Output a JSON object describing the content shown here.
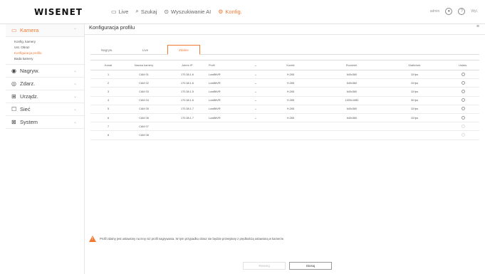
{
  "header": {
    "logo": "WISENET",
    "nav": [
      {
        "label": "Live",
        "icon": "monitor-icon"
      },
      {
        "label": "Szukaj",
        "icon": "search-icon"
      },
      {
        "label": "Wyszukiwanie AI",
        "icon": "ai-search-icon"
      },
      {
        "label": "Konfig.",
        "icon": "gear-icon"
      }
    ],
    "user": "admin",
    "help_icon": "?",
    "logout": "Wyl."
  },
  "sidebar": {
    "sections": [
      {
        "label": "Kamera",
        "icon": "camera-icon",
        "active": true,
        "items": [
          "Konfig. kamery",
          "Ust. Obraz",
          "Konfiguracja profilu",
          "Bada kamery"
        ]
      },
      {
        "label": "Nagryw.",
        "icon": "record-icon"
      },
      {
        "label": "Zdarz.",
        "icon": "event-icon"
      },
      {
        "label": "Urządz.",
        "icon": "device-icon"
      },
      {
        "label": "Sieć",
        "icon": "network-icon"
      },
      {
        "label": "System",
        "icon": "system-icon"
      }
    ]
  },
  "main": {
    "title": "Konfiguracja profilu",
    "menu_icon": "≡",
    "tabs": [
      "Nagryw.",
      "Live",
      "Zdalne"
    ],
    "active_tab": 2,
    "columns": [
      "Kanał",
      "Nazwa kamery",
      "Adres IP",
      "Profil",
      "Kodek",
      "Rozdziel.",
      "Klatki/sek",
      "Ustaw."
    ],
    "rows": [
      {
        "ch": "1",
        "name": "CAM 01",
        "ip": "170.38.1.6",
        "profile": "LowBitVR",
        "codec": "H.265",
        "res": "640x360",
        "fps": "15 fps"
      },
      {
        "ch": "2",
        "name": "CAM 02",
        "ip": "170.38.1.6",
        "profile": "LowBitVR",
        "codec": "H.265",
        "res": "640x360",
        "fps": "15 fps"
      },
      {
        "ch": "3",
        "name": "CAM 03",
        "ip": "170.38.1.5",
        "profile": "LowBitVR",
        "codec": "H.265",
        "res": "640x360",
        "fps": "15 fps"
      },
      {
        "ch": "4",
        "name": "CAM 04",
        "ip": "170.38.1.6",
        "profile": "LowBitVR",
        "codec": "H.265",
        "res": "1920x1080",
        "fps": "30 fps"
      },
      {
        "ch": "5",
        "name": "CAM 05",
        "ip": "170.38.1.7",
        "profile": "LowBitVR",
        "codec": "H.265",
        "res": "640x360",
        "fps": "15 fps"
      },
      {
        "ch": "6",
        "name": "CAM 06",
        "ip": "170.38.1.7",
        "profile": "LowBitVR",
        "codec": "H.265",
        "res": "640x360",
        "fps": "15 fps"
      },
      {
        "ch": "7",
        "name": "CAM 07",
        "ip": "",
        "profile": "",
        "codec": "",
        "res": "",
        "fps": ""
      },
      {
        "ch": "8",
        "name": "CAM 08",
        "ip": "",
        "profile": "",
        "codec": "",
        "res": "",
        "fps": ""
      }
    ],
    "warning": "Profil zdalny jest ustawiony na inny niż profil nagrywania. W tym przypadku obraz nie będzie przesyłany z prędkością ustawioną w kamerze.",
    "buttons": {
      "reset": "Resetuj",
      "apply": "Stosuj"
    }
  }
}
